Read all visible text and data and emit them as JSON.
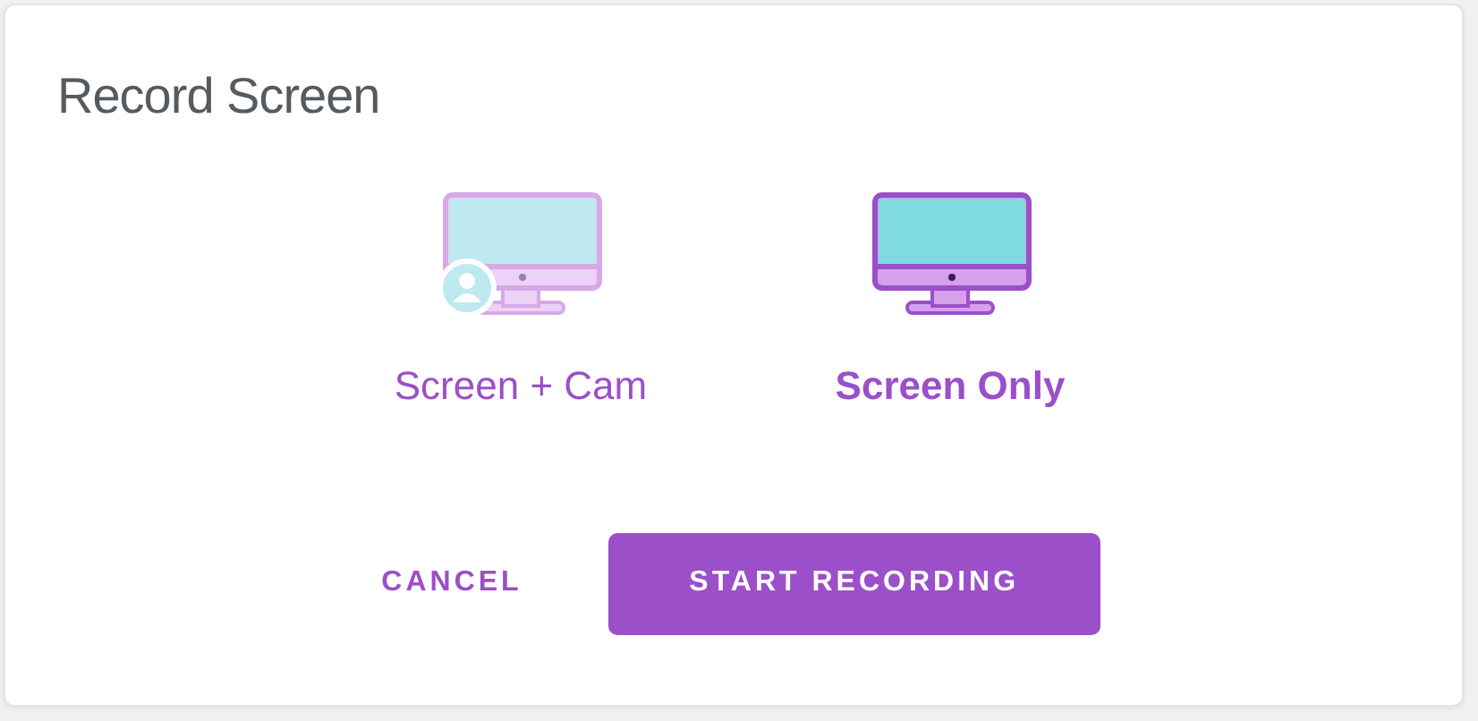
{
  "dialog": {
    "title": "Record Screen",
    "options": [
      {
        "kind": "screen_cam",
        "label": "Screen + Cam",
        "selected": false
      },
      {
        "kind": "screen",
        "label": "Screen Only",
        "selected": true
      }
    ],
    "buttons": [
      {
        "kind": "text",
        "label": "CANCEL"
      },
      {
        "kind": "primary",
        "label": "START RECORDING"
      }
    ]
  }
}
